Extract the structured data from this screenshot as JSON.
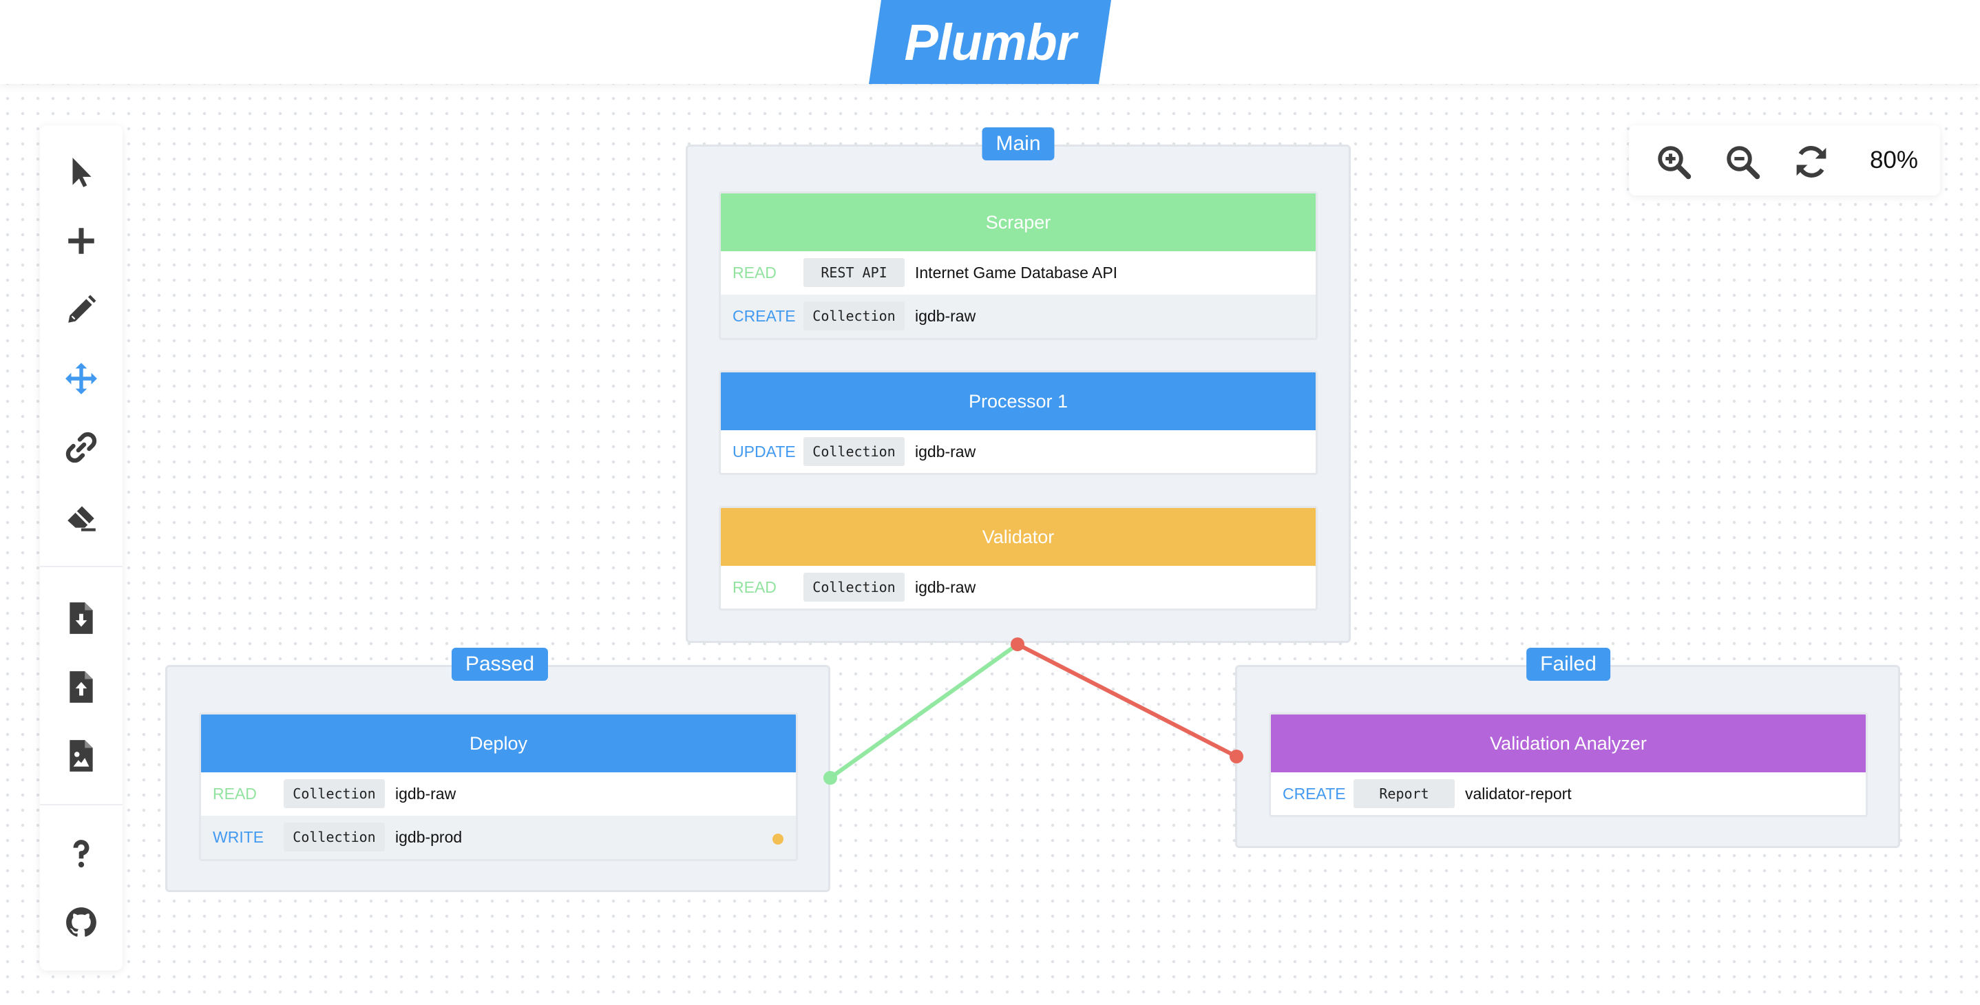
{
  "app": {
    "logo_text": "Plumbr",
    "brand_color": "#4299f0"
  },
  "toolbar": {
    "tools": [
      {
        "name": "select",
        "icon": "cursor-arrow-icon",
        "active": false
      },
      {
        "name": "add",
        "icon": "plus-icon",
        "active": false
      },
      {
        "name": "edit",
        "icon": "pencil-icon",
        "active": false
      },
      {
        "name": "move",
        "icon": "move-arrows-icon",
        "active": true
      },
      {
        "name": "link",
        "icon": "link-icon",
        "active": false
      },
      {
        "name": "erase",
        "icon": "eraser-icon",
        "active": false
      },
      {
        "name": "import",
        "icon": "file-download-icon",
        "active": false
      },
      {
        "name": "export",
        "icon": "file-upload-icon",
        "active": false
      },
      {
        "name": "export-image",
        "icon": "file-image-icon",
        "active": false
      },
      {
        "name": "help",
        "icon": "question-mark-icon",
        "active": false
      },
      {
        "name": "github",
        "icon": "github-icon",
        "active": false
      }
    ]
  },
  "zoom": {
    "level_text": "80%",
    "controls": [
      "zoom-in-icon",
      "zoom-out-icon",
      "reset-refresh-icon"
    ]
  },
  "groups": {
    "main": {
      "label": "Main",
      "stages": [
        {
          "title": "Scraper",
          "color": "#93e8a1",
          "rows": [
            {
              "op": "READ",
              "type": "REST API",
              "target": "Internet Game Database API"
            },
            {
              "op": "CREATE",
              "type": "Collection",
              "target": "igdb-raw"
            }
          ]
        },
        {
          "title": "Processor 1",
          "color": "#4299f0",
          "rows": [
            {
              "op": "UPDATE",
              "type": "Collection",
              "target": "igdb-raw"
            }
          ]
        },
        {
          "title": "Validator",
          "color": "#f3bf53",
          "rows": [
            {
              "op": "READ",
              "type": "Collection",
              "target": "igdb-raw"
            }
          ]
        }
      ]
    },
    "passed": {
      "label": "Passed",
      "stages": [
        {
          "title": "Deploy",
          "color": "#4299f0",
          "rows": [
            {
              "op": "READ",
              "type": "Collection",
              "target": "igdb-raw"
            },
            {
              "op": "WRITE",
              "type": "Collection",
              "target": "igdb-prod"
            }
          ]
        }
      ]
    },
    "failed": {
      "label": "Failed",
      "stages": [
        {
          "title": "Validation Analyzer",
          "color": "#b465da",
          "rows": [
            {
              "op": "CREATE",
              "type": "Report",
              "target": "validator-report"
            }
          ]
        }
      ]
    }
  },
  "connections": [
    {
      "from": "Validator",
      "to": "Passed",
      "color": "#93e8a1"
    },
    {
      "from": "Validator",
      "to": "Failed",
      "color": "#e8655a"
    }
  ],
  "colors": {
    "read": "#92e3a0",
    "write": "#4299f0",
    "status_warning": "#f3bf53",
    "icon_default": "#3d3d3d"
  }
}
